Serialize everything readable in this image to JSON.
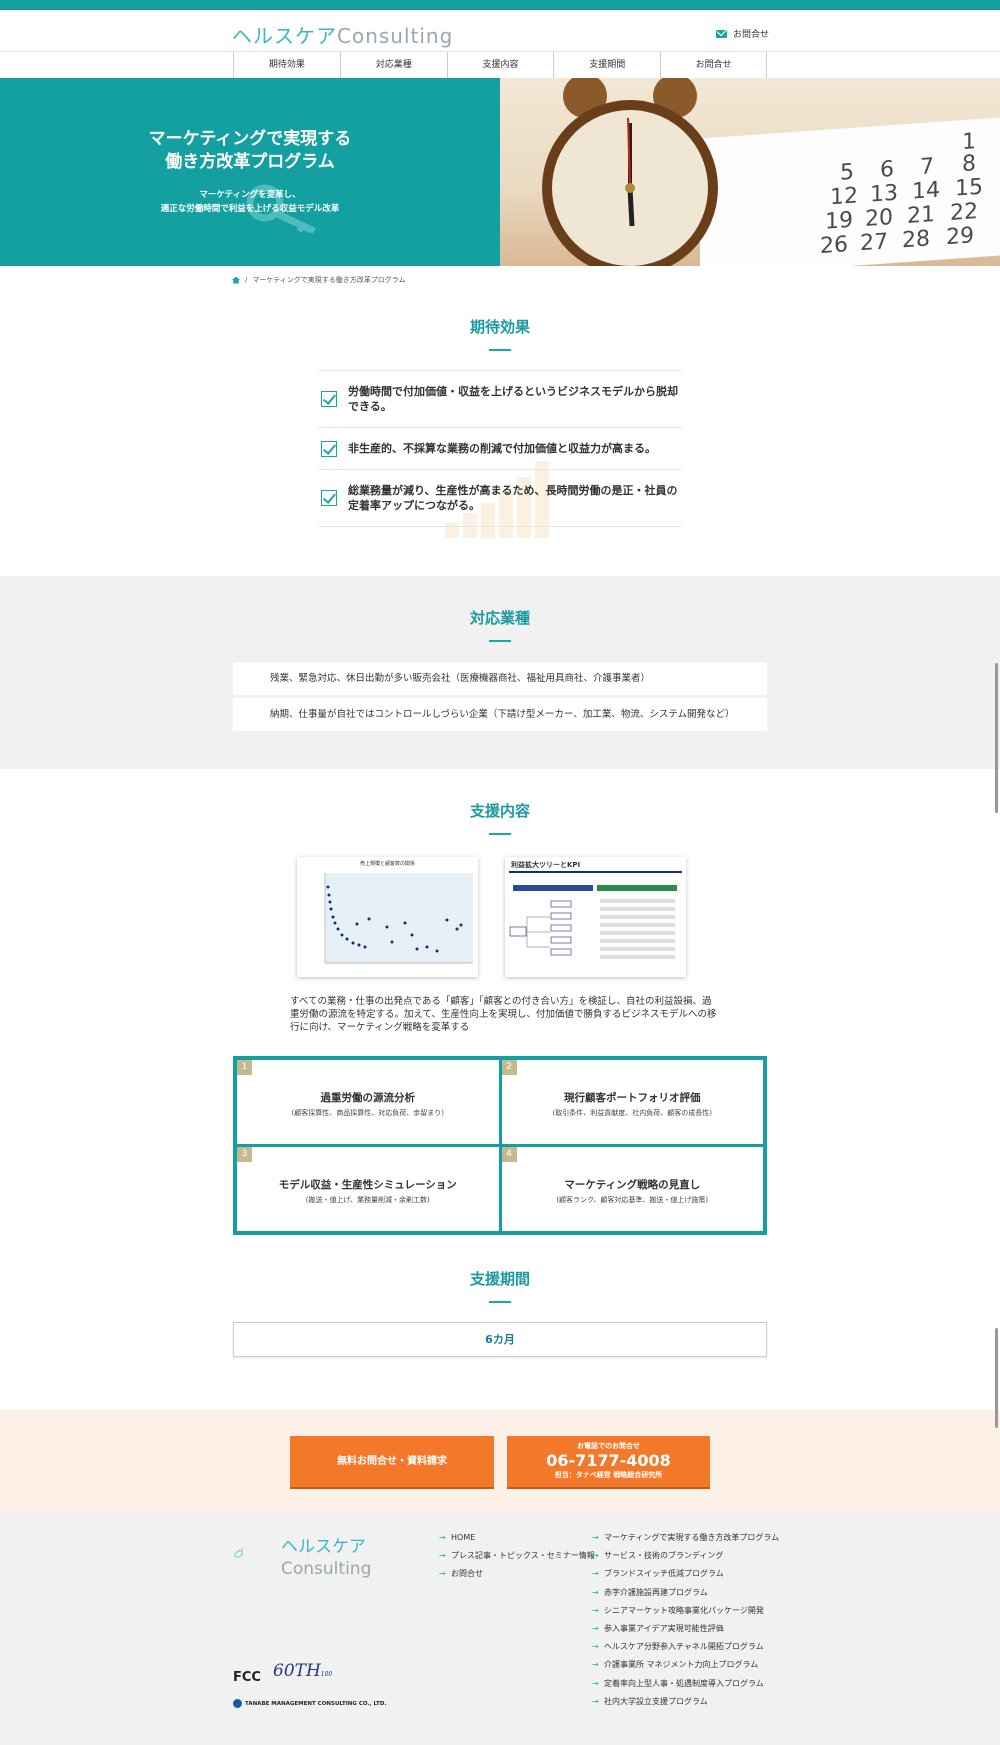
{
  "header": {
    "logo_jp": "ヘルスケア",
    "logo_en": "Consulting",
    "contact_label": "お問合せ"
  },
  "nav": [
    "期待効果",
    "対応業種",
    "支援内容",
    "支援期間",
    "お問合せ"
  ],
  "hero": {
    "title_line1": "マーケティングで実現する",
    "title_line2": "働き方改革プログラム",
    "sub_line1": "マーケティングを変革し、",
    "sub_line2": "適正な労働時間で利益を上げる収益モデル改革",
    "calendar_numbers": [
      "1",
      "5",
      "6",
      "7",
      "8",
      "12",
      "13",
      "14",
      "15",
      "19",
      "20",
      "21",
      "22",
      "26",
      "27",
      "28",
      "29"
    ]
  },
  "breadcrumb": {
    "current": "マーケティングで実現する働き方改革プログラム"
  },
  "effects": {
    "title": "期待効果",
    "items": [
      "労働時間で付加価値・収益を上げるというビジネスモデルから脱却できる。",
      "非生産的、不採算な業務の削減で付加価値と収益力が高まる。",
      "総業務量が減り、生産性が高まるため、長時間労働の是正・社員の定着率アップにつながる。"
    ]
  },
  "industries": {
    "title": "対応業種",
    "items": [
      "残業、緊急対応、休日出勤が多い販売会社（医療機器商社、福祉用具商社、介護事業者）",
      "納期、仕事量が自社ではコントロールしづらい企業（下請け型メーカー、加工業、物流、システム開発など）"
    ]
  },
  "support": {
    "title": "支援内容",
    "fig1_title": "売上規模と顧客数の関係",
    "fig2_title": "利益拡大ツリーとKPI",
    "description": "すべての業務・仕事の出発点である「顧客」「顧客との付き合い方」を検証し、自社の利益設損、過重労働の源流を特定する。加えて、生産性向上を実現し、付加価値で勝負するビジネスモデルへの移行に向け、マーケティング戦略を変革する",
    "cells": [
      {
        "num": "1",
        "title": "過重労働の源流分析",
        "sub": "(顧客採算性、商品採算性、対応負荷、歩留まり)"
      },
      {
        "num": "2",
        "title": "現行顧客ポートフォリオ評価",
        "sub": "(取引条件、利益貢献度、社内負荷、顧客の成長性)"
      },
      {
        "num": "3",
        "title": "モデル収益・生産性シミュレーション",
        "sub": "(搬送・値上げ、業務量削減・余剰工数)"
      },
      {
        "num": "4",
        "title": "マーケティング戦略の見直し",
        "sub": "(顧客ランク、顧客対応基準、搬送・値上げ施策)"
      }
    ]
  },
  "period": {
    "title": "支援期間",
    "value": "6カ月"
  },
  "cta": {
    "button1": "無料お問合せ・資料請求",
    "phone_label": "お電話でのお問合せ",
    "phone": "06-7177-4008",
    "phone_note": "担当：タナベ経営 戦略総合研究所"
  },
  "footer": {
    "logo_jp": "ヘルスケア",
    "logo_en": "Consulting",
    "links_col1": [
      "HOME",
      "プレス記事・トピックス・セミナー情報",
      "お問合せ"
    ],
    "links_col2": [
      "マーケティングで実現する働き方改革プログラム",
      "サービス・技術のブランディング",
      "ブランドスイッチ低減プログラム",
      "赤字介護施設再建プログラム",
      "シニアマーケット攻略事業化パッケージ開発",
      "参入事業アイデア実現可能性評価",
      "ヘルスケア分野参入チャネル開拓プログラム",
      "介護事業所 マネジメント力向上プログラム",
      "定着率向上型人事・処遇制度導入プログラム",
      "社内大学設立支援プログラム"
    ],
    "fcc": "FCC",
    "anniv": "60TH",
    "anniv2": "100",
    "company": "TANABE MANAGEMENT CONSULTING CO., LTD."
  },
  "colors": {
    "accent": "#159e9e",
    "cta": "#f4782a",
    "cell_number": "#c7b98f"
  }
}
